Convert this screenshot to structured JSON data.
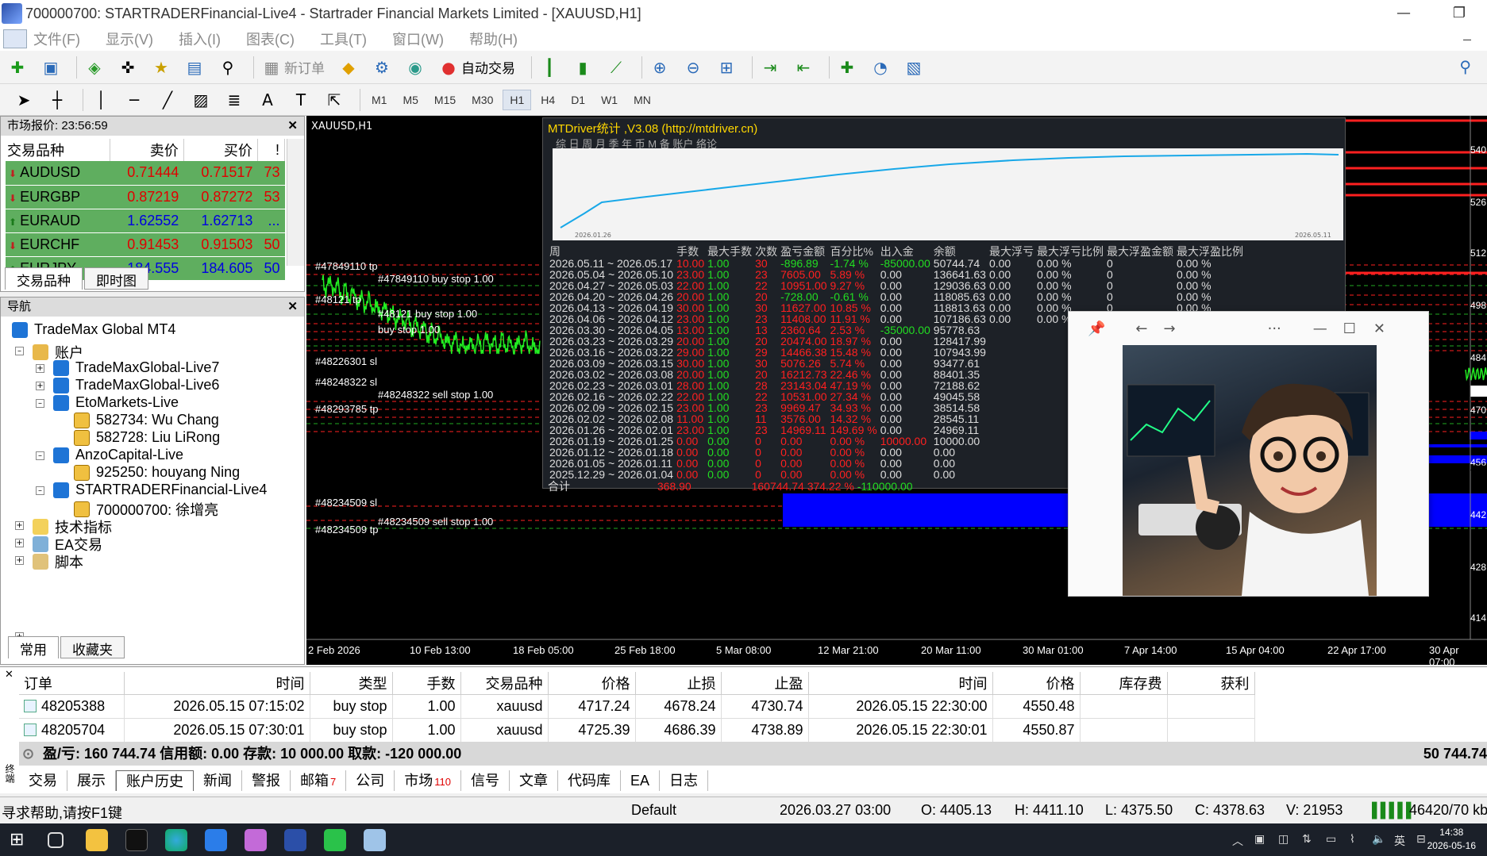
{
  "window": {
    "title": "700000700: STARTRADERFinancial-Live4 - Startrader Financial Markets Limited - [XAUUSD,H1]"
  },
  "menu": [
    "文件(F)",
    "显示(V)",
    "插入(I)",
    "图表(C)",
    "工具(T)",
    "窗口(W)",
    "帮助(H)"
  ],
  "toolbar": {
    "new_order": "新订单",
    "auto_trade": "自动交易"
  },
  "timeframes": [
    "M1",
    "M5",
    "M15",
    "M30",
    "H1",
    "H4",
    "D1",
    "W1",
    "MN"
  ],
  "active_timeframe": "H1",
  "market_watch": {
    "title": "市场报价: 23:56:59",
    "headers": [
      "交易品种",
      "卖价",
      "买价",
      "!"
    ],
    "rows": [
      {
        "symbol": "AUDUSD",
        "bid": "0.71444",
        "ask": "0.71517",
        "spread": "73",
        "dir": "dn"
      },
      {
        "symbol": "EURGBP",
        "bid": "0.87219",
        "ask": "0.87272",
        "spread": "53",
        "dir": "dn"
      },
      {
        "symbol": "EURAUD",
        "bid": "1.62552",
        "ask": "1.62713",
        "spread": "...",
        "dir": "up"
      },
      {
        "symbol": "EURCHF",
        "bid": "0.91453",
        "ask": "0.91503",
        "spread": "50",
        "dir": "dn"
      },
      {
        "symbol": "EURJPY",
        "bid": "184.555",
        "ask": "184.605",
        "spread": "50",
        "dir": "up"
      }
    ],
    "tabs": [
      "交易品种",
      "即时图"
    ]
  },
  "navigator": {
    "title": "导航",
    "root": "TradeMax Global MT4",
    "accounts_label": "账户",
    "servers": [
      {
        "name": "TradeMaxGlobal-Live7"
      },
      {
        "name": "TradeMaxGlobal-Live6"
      },
      {
        "name": "EtoMarkets-Live",
        "accounts": [
          "582734: Wu Chang",
          "582728: Liu LiRong"
        ]
      },
      {
        "name": "AnzoCapital-Live",
        "accounts": [
          "925250: houyang Ning"
        ]
      },
      {
        "name": "STARTRADERFinancial-Live4",
        "accounts": [
          "700000700: 徐增亮"
        ]
      }
    ],
    "groups": [
      "技术指标",
      "EA交易",
      "脚本"
    ],
    "tabs": [
      "常用",
      "收藏夹"
    ]
  },
  "chart": {
    "symbol": "XAUUSD,H1",
    "order_labels": [
      "#47849110 tp",
      "#47849110 buy stop 1.00",
      "#48121 tp",
      "#48121 buy stop 1.00",
      "buy stop 1.00",
      "#48226301 sl",
      "#48248322 sl",
      "#48248322 sell stop 1.00",
      "#48293785 tp",
      "#48234509 sl",
      "#48234509 sell stop 1.00",
      "#48234509 tp"
    ],
    "x_labels": [
      "2 Feb 2026",
      "10 Feb 13:00",
      "18 Feb 05:00",
      "25 Feb 18:00",
      "5 Mar 08:00",
      "12 Mar 21:00",
      "20 Mar 11:00",
      "30 Mar 01:00",
      "7 Apr 14:00",
      "15 Apr 04:00",
      "22 Apr 17:00",
      "30 Apr 07:00"
    ],
    "y_labels": [
      "540",
      "526",
      "512",
      "498",
      "484",
      "470",
      "456",
      "442",
      "428",
      "414"
    ],
    "current_price": "453"
  },
  "mtdriver": {
    "title": "MTDriver统计 ,V3.08 (http://mtdriver.cn)",
    "tabs": "综 日 周 月 季 年 币 M 备 账户        络论",
    "curve_start": "2026.01.26",
    "curve_end": "2026.05.11",
    "headers": [
      "周",
      "手数",
      "最大手数",
      "次数",
      "盈亏金额",
      "百分比%",
      "出入金",
      "余额",
      "最大浮亏",
      "最大浮亏比例",
      "最大浮盈金额",
      "最大浮盈比例"
    ],
    "rows": [
      [
        "2026.05.11 ~ 2026.05.17",
        "10.00",
        "1.00",
        "30",
        "-896.89",
        "-1.74 %",
        "-85000.00",
        "50744.74",
        "0.00",
        "0.00 %",
        "0",
        "0.00 %"
      ],
      [
        "2026.05.04 ~ 2026.05.10",
        "23.00",
        "1.00",
        "23",
        "7605.00",
        "5.89 %",
        "0.00",
        "136641.63",
        "0.00",
        "0.00 %",
        "0",
        "0.00 %"
      ],
      [
        "2026.04.27 ~ 2026.05.03",
        "22.00",
        "1.00",
        "22",
        "10951.00",
        "9.27 %",
        "0.00",
        "129036.63",
        "0.00",
        "0.00 %",
        "0",
        "0.00 %"
      ],
      [
        "2026.04.20 ~ 2026.04.26",
        "20.00",
        "1.00",
        "20",
        "-728.00",
        "-0.61 %",
        "0.00",
        "118085.63",
        "0.00",
        "0.00 %",
        "0",
        "0.00 %"
      ],
      [
        "2026.04.13 ~ 2026.04.19",
        "30.00",
        "1.00",
        "30",
        "11627.00",
        "10.85 %",
        "0.00",
        "118813.63",
        "0.00",
        "0.00 %",
        "0",
        "0.00 %"
      ],
      [
        "2026.04.06 ~ 2026.04.12",
        "23.00",
        "1.00",
        "23",
        "11408.00",
        "11.91 %",
        "0.00",
        "107186.63",
        "0.00",
        "0.00 %",
        "0",
        "0.00 %"
      ],
      [
        "2026.03.30 ~ 2026.04.05",
        "13.00",
        "1.00",
        "13",
        "2360.64",
        "2.53 %",
        "-35000.00",
        "95778.63",
        "",
        "",
        "",
        ""
      ],
      [
        "2026.03.23 ~ 2026.03.29",
        "20.00",
        "1.00",
        "20",
        "20474.00",
        "18.97 %",
        "0.00",
        "128417.99",
        "",
        "",
        "",
        ""
      ],
      [
        "2026.03.16 ~ 2026.03.22",
        "29.00",
        "1.00",
        "29",
        "14466.38",
        "15.48 %",
        "0.00",
        "107943.99",
        "",
        "",
        "",
        ""
      ],
      [
        "2026.03.09 ~ 2026.03.15",
        "30.00",
        "1.00",
        "30",
        "5076.26",
        "5.74 %",
        "0.00",
        "93477.61",
        "",
        "",
        "",
        ""
      ],
      [
        "2026.03.02 ~ 2026.03.08",
        "20.00",
        "1.00",
        "20",
        "16212.73",
        "22.46 %",
        "0.00",
        "88401.35",
        "",
        "",
        "",
        ""
      ],
      [
        "2026.02.23 ~ 2026.03.01",
        "28.00",
        "1.00",
        "28",
        "23143.04",
        "47.19 %",
        "0.00",
        "72188.62",
        "",
        "",
        "",
        ""
      ],
      [
        "2026.02.16 ~ 2026.02.22",
        "22.00",
        "1.00",
        "22",
        "10531.00",
        "27.34 %",
        "0.00",
        "49045.58",
        "",
        "",
        "",
        ""
      ],
      [
        "2026.02.09 ~ 2026.02.15",
        "23.00",
        "1.00",
        "23",
        "9969.47",
        "34.93 %",
        "0.00",
        "38514.58",
        "",
        "",
        "",
        ""
      ],
      [
        "2026.02.02 ~ 2026.02.08",
        "11.00",
        "1.00",
        "11",
        "3576.00",
        "14.32 %",
        "0.00",
        "28545.11",
        "",
        "",
        "",
        ""
      ],
      [
        "2026.01.26 ~ 2026.02.01",
        "23.00",
        "1.00",
        "23",
        "14969.11",
        "149.69 %",
        "0.00",
        "24969.11",
        "",
        "",
        "",
        ""
      ],
      [
        "2026.01.19 ~ 2026.01.25",
        "0.00",
        "0.00",
        "0",
        "0.00",
        "0.00 %",
        "10000.00",
        "10000.00",
        "",
        "",
        "",
        ""
      ],
      [
        "2026.01.12 ~ 2026.01.18",
        "0.00",
        "0.00",
        "0",
        "0.00",
        "0.00 %",
        "0.00",
        "0.00",
        "",
        "",
        "",
        ""
      ],
      [
        "2026.01.05 ~ 2026.01.11",
        "0.00",
        "0.00",
        "0",
        "0.00",
        "0.00 %",
        "0.00",
        "0.00",
        "",
        "",
        "",
        ""
      ],
      [
        "2025.12.29 ~ 2026.01.04",
        "0.00",
        "0.00",
        "0",
        "0.00",
        "0.00 %",
        "0.00",
        "0.00",
        "",
        "",
        "",
        ""
      ]
    ],
    "total_label": "合计",
    "total_lots": "368.90",
    "total_pl": "160744.74",
    "total_pct": "374.22 %",
    "total_flow": "-110000.00"
  },
  "terminal": {
    "headers": [
      "订单",
      "时间",
      "类型",
      "手数",
      "交易品种",
      "价格",
      "止损",
      "止盈",
      "时间",
      "价格",
      "库存费",
      "获利"
    ],
    "rows": [
      [
        "48205388",
        "2026.05.15 07:15:02",
        "buy stop",
        "1.00",
        "xauusd",
        "4717.24",
        "4678.24",
        "4730.74",
        "2026.05.15 22:30:00",
        "4550.48",
        "",
        ""
      ],
      [
        "48205704",
        "2026.05.15 07:30:01",
        "buy stop",
        "1.00",
        "xauusd",
        "4725.39",
        "4686.39",
        "4738.89",
        "2026.05.15 22:30:01",
        "4550.87",
        "",
        ""
      ]
    ],
    "summary": "盈/亏: 160 744.74 信用额: 0.00 存款: 10 000.00 取款: -120 000.00",
    "balance": "50 744.74",
    "tabs": [
      {
        "label": "交易",
        "badge": ""
      },
      {
        "label": "展示",
        "badge": ""
      },
      {
        "label": "账户历史",
        "badge": ""
      },
      {
        "label": "新闻",
        "badge": ""
      },
      {
        "label": "警报",
        "badge": ""
      },
      {
        "label": "邮箱",
        "badge": "7"
      },
      {
        "label": "公司",
        "badge": ""
      },
      {
        "label": "市场",
        "badge": "110"
      },
      {
        "label": "信号",
        "badge": ""
      },
      {
        "label": "文章",
        "badge": ""
      },
      {
        "label": "代码库",
        "badge": ""
      },
      {
        "label": "EA",
        "badge": ""
      },
      {
        "label": "日志",
        "badge": ""
      }
    ],
    "active_tab": "账户历史",
    "side_label": "终端"
  },
  "statusbar": {
    "help": "寻求帮助,请按F1键",
    "profile": "Default",
    "datetime": "2026.03.27 03:00",
    "open": "O: 4405.13",
    "high": "H: 4411.10",
    "low": "L: 4375.50",
    "close": "C: 4378.63",
    "volume": "V: 21953",
    "traffic": "46420/70 kb"
  },
  "taskbar": {
    "ime": "英",
    "time": "14:38",
    "date": "2026-05-16"
  },
  "colors": {
    "bull": "#22ee22",
    "bear": "#ff2020",
    "sl_line": "#ff2020",
    "fill_blue": "#0000ff",
    "mw_row": "#5fae5f"
  }
}
